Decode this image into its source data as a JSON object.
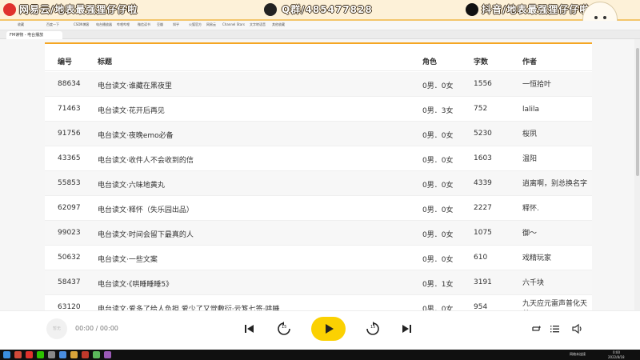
{
  "banner": {
    "left_text": "网易云/地表最强狸仔仔啦",
    "mid_text": "Q群/485477828",
    "right_text": "抖音/地表最强狸仔仔啦"
  },
  "browser": {
    "bookmarks": [
      "收藏",
      "百度一下",
      "CSDN博客",
      "电台播放器",
      "哔哩哔哩",
      "微信读书",
      "豆瓣",
      "知乎",
      "火狐官方",
      "网易云",
      "Channel Stars",
      "文字转语音",
      "其他收藏"
    ],
    "tab_title": "FM读物 - 电台播放"
  },
  "table": {
    "headers": {
      "id": "编号",
      "title": "标题",
      "roles": "角色",
      "words": "字数",
      "author": "作者"
    },
    "rows": [
      {
        "id": "88634",
        "title": "电台读文·谁藏在黑夜里",
        "roles": "0男．0女",
        "words": "1556",
        "author": "一恒拾叶"
      },
      {
        "id": "71463",
        "title": "电台读文·花开后再见",
        "roles": "0男．3女",
        "words": "752",
        "author": "lalila"
      },
      {
        "id": "91756",
        "title": "电台读文·夜晚emo必备",
        "roles": "0男．0女",
        "words": "5230",
        "author": "桜夙"
      },
      {
        "id": "43365",
        "title": "电台读文·收件人不会收到的信",
        "roles": "0男．0女",
        "words": "1603",
        "author": "温阳"
      },
      {
        "id": "55853",
        "title": "电台读文·六味地黄丸",
        "roles": "0男．0女",
        "words": "4339",
        "author": "逍离啊，别总换名字"
      },
      {
        "id": "62097",
        "title": "电台读文·释怀（失乐园出品）",
        "roles": "0男．0女",
        "words": "2227",
        "author": "释怀."
      },
      {
        "id": "99023",
        "title": "电台读文·时间会留下最真的人",
        "roles": "0男．0女",
        "words": "1075",
        "author": "御～"
      },
      {
        "id": "50632",
        "title": "电台读文·一些文案",
        "roles": "0男．0女",
        "words": "610",
        "author": "戏精玩家"
      },
      {
        "id": "58437",
        "title": "电台读文·《哄睡睡睡5》",
        "roles": "0男．1女",
        "words": "3191",
        "author": "六千块"
      },
      {
        "id": "63120",
        "title": "电台读文·爱多了给人负担 爱少了又觉敷衍·云笈七签·哄睡",
        "roles": "0男．0女",
        "words": "954",
        "author": "九天应元雷声普化天尊"
      }
    ]
  },
  "player": {
    "time": "00:00 / 00:00",
    "cover_label": "暂无",
    "skip_back_label": "15",
    "skip_fwd_label": "15"
  },
  "taskbar": {
    "tray_text": "网络未连接",
    "clock_time": "0:00",
    "clock_date": "2022/8/18"
  },
  "colors": {
    "accent": "#fbd102",
    "border_accent": "#f5a623",
    "taskbar": "#101010"
  }
}
